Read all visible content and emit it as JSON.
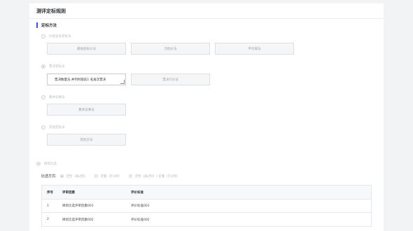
{
  "panel_title": "测评定标规则",
  "section_title": "定标方法",
  "options": {
    "opt1": "价格竞争定标法",
    "opt2": "票决定标法",
    "opt3": "集体议事法",
    "opt4": "其他定标法",
    "opt5": "择优比选"
  },
  "buttons": {
    "lowest_price": "最低投标价法",
    "second_low": "次低价法",
    "average": "平均值法",
    "vote_input": "票决数量法 并列时取前1 名再次票决",
    "vote_count": "票决计分法",
    "collective": "集体议事法",
    "other": "其他方法"
  },
  "compare": {
    "label": "比选方式:",
    "opts": [
      "定性（通过制）",
      "定量（打分制）",
      "定性（通过制）+定量（打分制）"
    ]
  },
  "table": {
    "headers": [
      "序号",
      "评审因素",
      "评价标准"
    ],
    "rows": [
      [
        "1",
        "择优比选评审因素001",
        "评价标准001"
      ],
      [
        "2",
        "择优比选评审因素002",
        "评价标准002"
      ]
    ]
  }
}
